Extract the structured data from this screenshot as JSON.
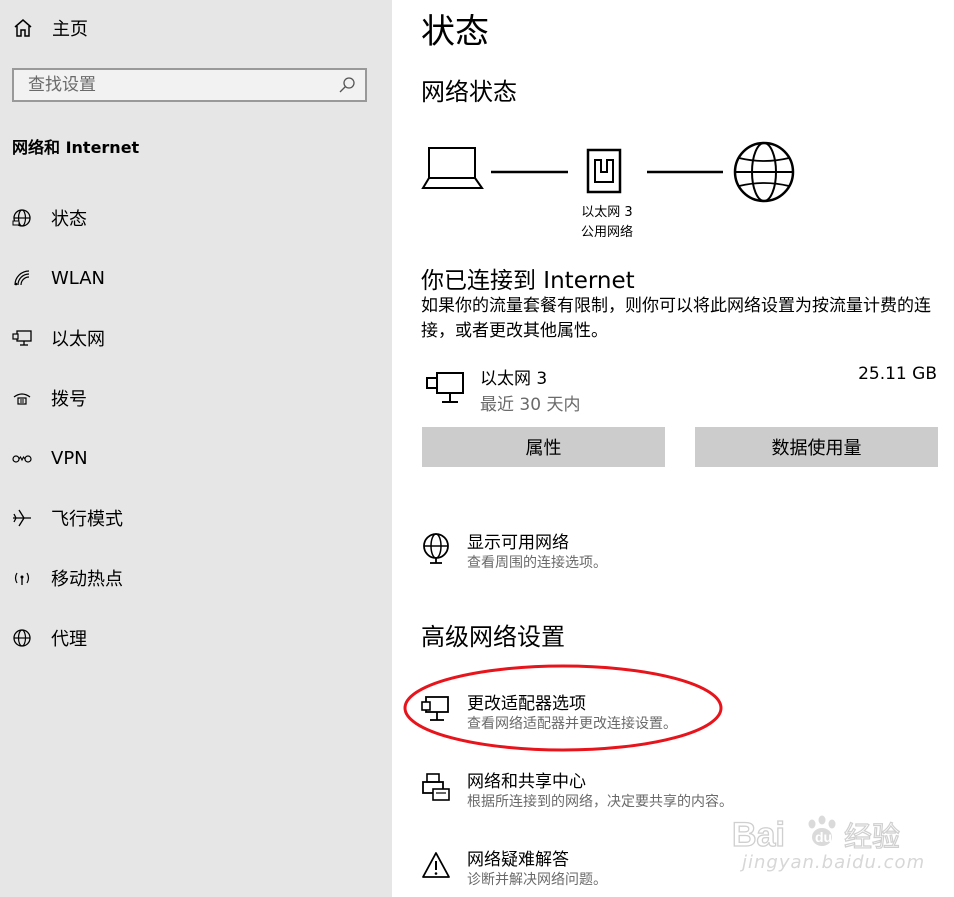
{
  "sidebar": {
    "home_label": "主页",
    "search_placeholder": "查找设置",
    "section_title": "网络和 Internet",
    "items": [
      {
        "label": "状态",
        "icon": "globe-icon"
      },
      {
        "label": "WLAN",
        "icon": "wifi-icon"
      },
      {
        "label": "以太网",
        "icon": "ethernet-icon"
      },
      {
        "label": "拨号",
        "icon": "dialup-icon"
      },
      {
        "label": "VPN",
        "icon": "vpn-icon"
      },
      {
        "label": "飞行模式",
        "icon": "airplane-icon"
      },
      {
        "label": "移动热点",
        "icon": "hotspot-icon"
      },
      {
        "label": "代理",
        "icon": "globe-icon"
      }
    ]
  },
  "main": {
    "title": "状态",
    "network_status_heading": "网络状态",
    "diagram": {
      "adapter_name": "以太网 3",
      "network_type": "公用网络"
    },
    "connected_title": "你已连接到 Internet",
    "connected_desc": "如果你的流量套餐有限制，则你可以将此网络设置为按流量计费的连接，或者更改其他属性。",
    "adapter": {
      "name": "以太网 3",
      "period": "最近 30 天内",
      "usage": "25.11 GB"
    },
    "buttons": {
      "properties": "属性",
      "data_usage": "数据使用量"
    },
    "show_networks": {
      "title": "显示可用网络",
      "subtitle": "查看周围的连接选项。"
    },
    "advanced_heading": "高级网络设置",
    "advanced_items": [
      {
        "title": "更改适配器选项",
        "subtitle": "查看网络适配器并更改连接设置。",
        "icon": "adapter-icon"
      },
      {
        "title": "网络和共享中心",
        "subtitle": "根据所连接到的网络，决定要共享的内容。",
        "icon": "sharing-center-icon"
      },
      {
        "title": "网络疑难解答",
        "subtitle": "诊断并解决网络问题。",
        "icon": "warning-icon"
      }
    ]
  },
  "watermark": {
    "brand": "Baidu经验",
    "url": "jingyan.baidu.com"
  },
  "colors": {
    "sidebar_bg": "#e6e6e6",
    "button_bg": "#cccccc",
    "annotation_red": "#e8141c",
    "secondary_text": "#6a6a6a"
  }
}
